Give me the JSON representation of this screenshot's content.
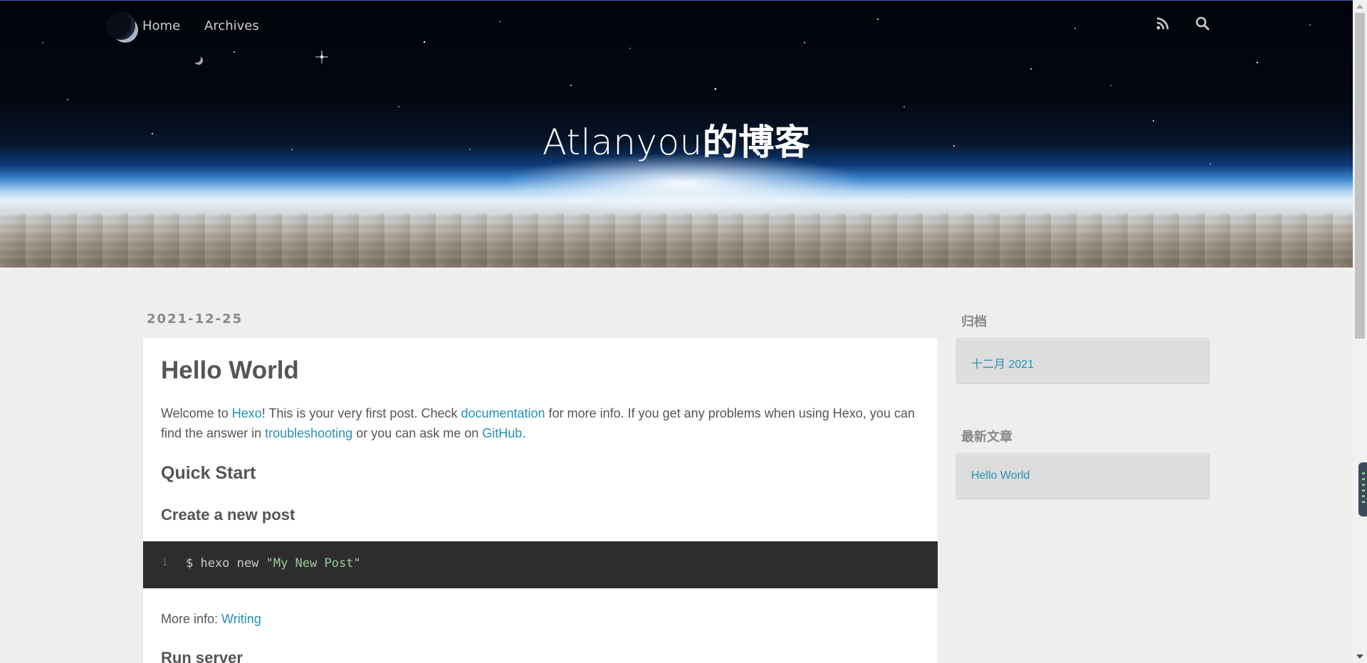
{
  "nav": {
    "home": "Home",
    "archives": "Archives"
  },
  "icons": {
    "logo": "moon-logo-icon",
    "rss": "rss-icon",
    "search": "search-icon"
  },
  "site": {
    "title_latin": "Atlanyou",
    "title_cjk": "的博客"
  },
  "post": {
    "date": "2021-12-25",
    "title": "Hello World",
    "intro": {
      "t1": "Welcome to ",
      "link_hexo": "Hexo",
      "t2": "! This is your very first post. Check ",
      "link_docs": "documentation",
      "t3": " for more info. If you get any problems when using Hexo, you can find the answer in ",
      "link_trouble": "troubleshooting",
      "t4": " or you can ask me on ",
      "link_github": "GitHub",
      "t5": "."
    },
    "h_quick_start": "Quick Start",
    "h_create_post": "Create a new post",
    "code": {
      "line_number": "1",
      "command": "$ hexo new ",
      "string": "\"My New Post\""
    },
    "more_info_label": "More info: ",
    "more_info_link": "Writing",
    "h_run_server": "Run server"
  },
  "sidebar": {
    "archive_title": "归档",
    "archive_link": "十二月 2021",
    "recent_title": "最新文章",
    "recent_link": "Hello World"
  },
  "colors": {
    "link": "#258fb8",
    "background": "#eeeeee",
    "code_bg": "#2d2d2d",
    "code_string": "#99cc99"
  }
}
